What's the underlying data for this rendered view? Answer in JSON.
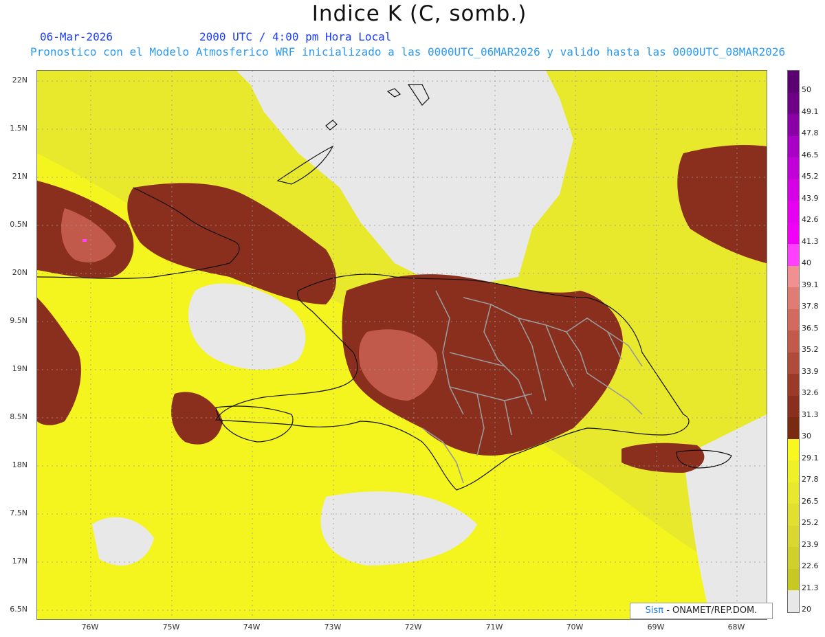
{
  "title": "Indice K (C, somb.)",
  "date": "06-Mar-2026",
  "time": "2000 UTC / 4:00 pm Hora Local",
  "forecast_line": "Pronostico con el Modelo Atmosferico WRF inicializado a las 0000UTC_06MAR2026 y valido hasta las  0000UTC_08MAR2026",
  "credit_brand": "Sisπ",
  "credit_org": " - ONAMET/REP.DOM.",
  "lat_labels": [
    "22N",
    "1.5N",
    "21N",
    "0.5N",
    "20N",
    "9.5N",
    "19N",
    "8.5N",
    "18N",
    "7.5N",
    "17N",
    "6.5N"
  ],
  "lon_labels": [
    "76W",
    "75W",
    "74W",
    "73W",
    "72W",
    "71W",
    "70W",
    "69W",
    "68W"
  ],
  "colorbar": {
    "labels": [
      "50",
      "49.1",
      "47.8",
      "46.5",
      "45.2",
      "43.9",
      "42.6",
      "41.3",
      "40",
      "39.1",
      "37.8",
      "36.5",
      "35.2",
      "33.9",
      "32.6",
      "31.3",
      "30",
      "29.1",
      "27.8",
      "26.5",
      "25.2",
      "23.9",
      "22.6",
      "21.3",
      "20"
    ],
    "colors": [
      "#5a0070",
      "#6e0088",
      "#8a00a6",
      "#a800c4",
      "#c000d6",
      "#d600e6",
      "#e600f0",
      "#f000f6",
      "#ff40ff",
      "#f09090",
      "#e07c74",
      "#d26a60",
      "#c25a4c",
      "#b04a3a",
      "#9c3a2a",
      "#8a2e1e",
      "#7a2a10",
      "#f8f820",
      "#f0f028",
      "#e8e82c",
      "#e0e030",
      "#d8d830",
      "#d0d02a",
      "#c8c822",
      "#e8e8e8"
    ]
  },
  "colors": {
    "title": "#111111",
    "date": "#1a3cff",
    "forecast": "#2b9af3",
    "land_bg": "#e8e8e8"
  }
}
